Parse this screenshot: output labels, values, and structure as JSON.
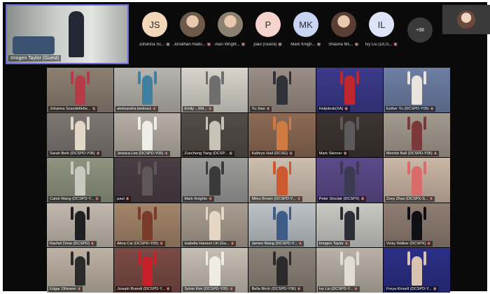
{
  "pinned": {
    "name": "Imogen Taylor (Guest)"
  },
  "attendees": [
    {
      "initials": "JS",
      "name": "Johanna Sc...",
      "color": "#f3d7b9"
    },
    {
      "initials": "",
      "name": "Jonathan Hado...",
      "color": "#6d5a4a",
      "photo": true
    },
    {
      "initials": "",
      "name": "Alan Wright...",
      "color": "#8a8070",
      "photo": true
    },
    {
      "initials": "P",
      "name": "paul (Guest)",
      "color": "#f6d3cc"
    },
    {
      "initials": "MK",
      "name": "Mark Knigh...",
      "color": "#c9d6f3"
    },
    {
      "initials": "",
      "name": "Shauna Mc...",
      "color": "#5a3d35",
      "photo": true
    },
    {
      "initials": "IL",
      "name": "Ivy Liu (DCS...",
      "color": "#dde4f5"
    }
  ],
  "more_count": "+98",
  "tiles": [
    {
      "name": "Johanna Scandellebe...",
      "bg": "#8d7f72",
      "fig": "#b53b46"
    },
    {
      "name": "aleksandra.bednarz",
      "bg": "#b7b4ad",
      "fig": "#3f7fa0"
    },
    {
      "name": "Emily ...5M...",
      "bg": "#d8d4cc",
      "fig": "#6e6e6e"
    },
    {
      "name": "Yu Xiao",
      "bg": "#9a8e85",
      "fig": "#2f3238"
    },
    {
      "name": "Helpdesk(XA)",
      "bg": "#3b3a8c",
      "fig": "#c0272d"
    },
    {
      "name": "Esther Yu (DCSPD-Y05)",
      "bg": "#6e7fa4",
      "fig": "#e8e4dc"
    },
    {
      "name": "Sarah Berk (DCSPD-Y06)",
      "bg": "#7d7773",
      "fig": "#e3d7c8"
    },
    {
      "name": "Jessica Lee (DCSPD-Y06)",
      "bg": "#b6aea5",
      "fig": "#f0eee9"
    },
    {
      "name": "Zuocheng Yang (DCSP...",
      "bg": "#544c46",
      "fig": "#c9c2b6"
    },
    {
      "name": "Kathryn Hall (DCSG)",
      "bg": "#8c6a55",
      "fig": "#cf7b43"
    },
    {
      "name": "Mark Skinner",
      "bg": "#3c3431",
      "fig": "#5b5959"
    },
    {
      "name": "Merrick Ball (DCSPD-Y05)",
      "bg": "#a49a8f",
      "fig": "#7a3a3a"
    },
    {
      "name": "Caleb Wang (DCSPD-Y...",
      "bg": "#8f9480",
      "fig": "#c7c9bf"
    },
    {
      "name": "paul",
      "bg": "#4a3e45",
      "fig": "#5e5757"
    },
    {
      "name": "Mark Knights",
      "bg": "#9c9d9b",
      "fig": "#3a3a3a"
    },
    {
      "name": "Miles Brown (DCSPD-Y...",
      "bg": "#cdbfb0",
      "fig": "#cc5a2e"
    },
    {
      "name": "Peter Sinclair (DCSPX)",
      "bg": "#5d4a8a",
      "fig": "#3a3a52"
    },
    {
      "name": "Zoey Zhao (DCSPX-S...",
      "bg": "#cbb7a6",
      "fig": "#d96b6b"
    },
    {
      "name": "Rachel Drew (DCSPD)",
      "bg": "#c2b8ad",
      "fig": "#1f1f22"
    },
    {
      "name": "Alina Cai (DCSPD-Y05)",
      "bg": "#a4856a",
      "fig": "#7b3b2b"
    },
    {
      "name": "Isabella Hanson Uri (Gu...",
      "bg": "#a99d90",
      "fig": "#e6d6c4"
    },
    {
      "name": "James Wang (DCSPD-Y...",
      "bg": "#bcc2c6",
      "fig": "#3c5b86"
    },
    {
      "name": "Imogen Taylor",
      "bg": "#c9c9c4",
      "fig": "#2c2f36"
    },
    {
      "name": "Vicky Walker (DCSPX)",
      "bg": "#8f7d72",
      "fig": "#101014"
    },
    {
      "name": "Edgar Zillmann",
      "bg": "#bdb2a4",
      "fig": "#2a2a2a"
    },
    {
      "name": "Joseph Brandt (DCSPD-Y...",
      "bg": "#7c4b45",
      "fig": "#c8202b"
    },
    {
      "name": "Sylvie Kim (DCSPD-Y05)",
      "bg": "#c6bdb3",
      "fig": "#efece6"
    },
    {
      "name": "Bella Birch (DCSPD-Y06)",
      "bg": "#8c8378",
      "fig": "#2b2a2c"
    },
    {
      "name": "Ivy Liu (DCSPD-Y...",
      "bg": "#b9b1a6",
      "fig": "#e2ddd3"
    },
    {
      "name": "Freya Kinsell (DCSPD-Y...",
      "bg": "#2b2f86",
      "fig": "#d8c3b2"
    }
  ]
}
